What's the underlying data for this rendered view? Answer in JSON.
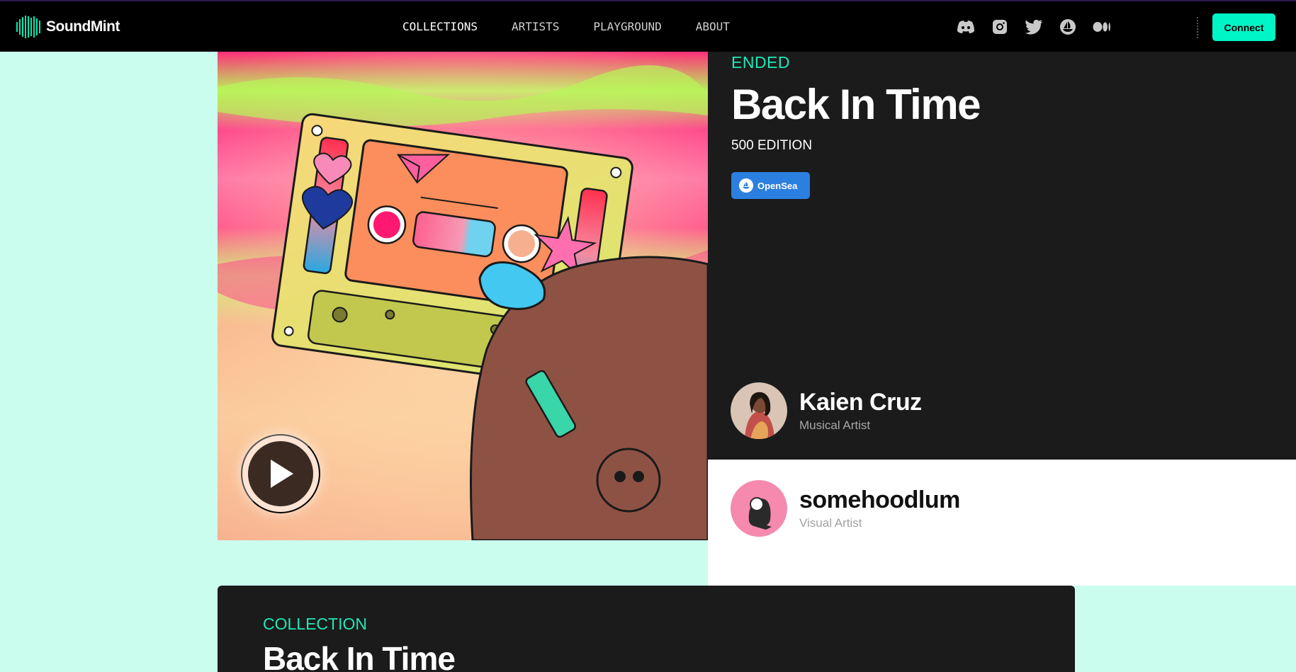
{
  "header": {
    "logo_text": "SoundMint",
    "nav": [
      {
        "label": "COLLECTIONS",
        "active": true
      },
      {
        "label": "ARTISTS",
        "active": false
      },
      {
        "label": "PLAYGROUND",
        "active": false
      },
      {
        "label": "ABOUT",
        "active": false
      }
    ],
    "socials": [
      "discord-icon",
      "instagram-icon",
      "twitter-icon",
      "opensea-icon",
      "medium-icon"
    ],
    "connect_label": "Connect"
  },
  "release": {
    "status": "ENDED",
    "title": "Back In Time",
    "edition": "500 EDITION",
    "marketplace_label": "OpenSea"
  },
  "credits": [
    {
      "name": "Kaien Cruz",
      "role": "Musical Artist"
    },
    {
      "name": "somehoodlum",
      "role": "Visual Artist"
    }
  ],
  "collection": {
    "label": "COLLECTION",
    "title": "Back In Time"
  },
  "colors": {
    "accent": "#00f5c6",
    "status_text": "#1fe8b8",
    "panel_dark": "#1b1b1b",
    "page_bg": "#cbfdee",
    "opensea_blue": "#2b7fe0"
  }
}
